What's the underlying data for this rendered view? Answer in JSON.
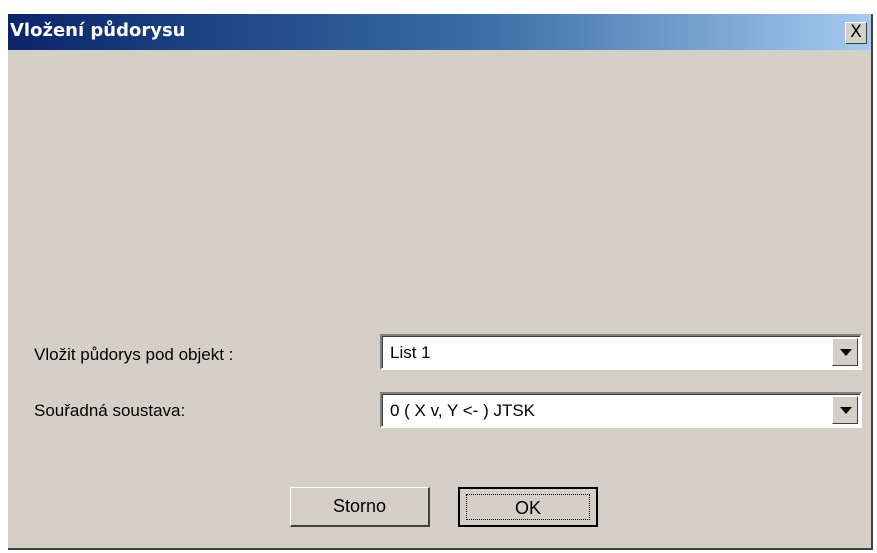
{
  "window": {
    "title": "Vložení půdorysu",
    "close_label": "X"
  },
  "form": {
    "object_label": "Vložit půdorys pod objekt :",
    "object_value": "List 1",
    "coords_label": "Souřadná soustava:",
    "coords_value": "0 ( X v,  Y <- ) JTSK"
  },
  "buttons": {
    "cancel_label": "Storno",
    "ok_label": "OK"
  },
  "colors": {
    "titlebar_start": "#0a246a",
    "titlebar_end": "#a6caf0",
    "dialog_bg": "#d4d0c8"
  },
  "icons": {
    "close": "close-icon",
    "dropdown": "chevron-down-icon"
  }
}
